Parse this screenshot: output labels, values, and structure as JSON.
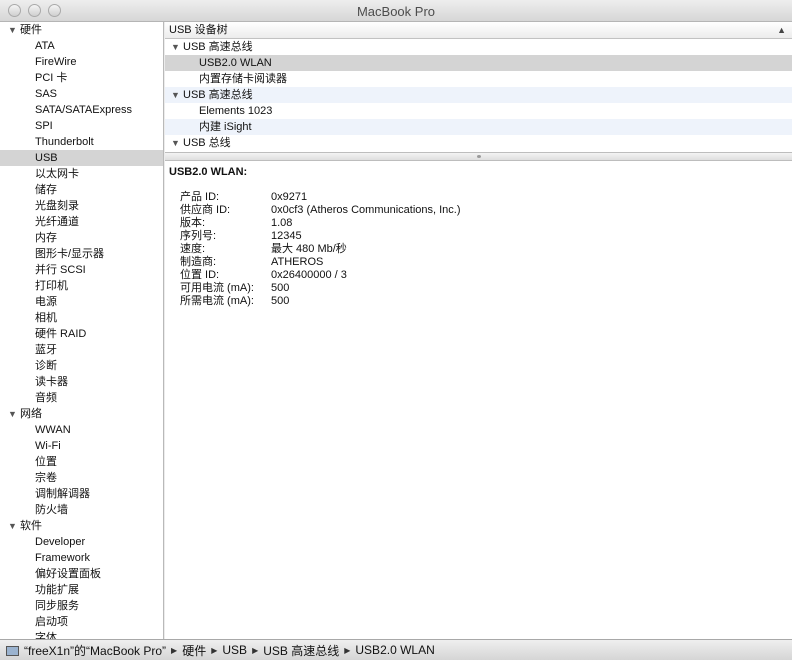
{
  "window": {
    "title": "MacBook Pro"
  },
  "sidebar": {
    "sections": [
      {
        "label": "硬件",
        "items": [
          "ATA",
          "FireWire",
          "PCI 卡",
          "SAS",
          "SATA/SATAExpress",
          "SPI",
          "Thunderbolt",
          "USB",
          "以太网卡",
          "储存",
          "光盘刻录",
          "光纤通道",
          "内存",
          "图形卡/显示器",
          "并行 SCSI",
          "打印机",
          "电源",
          "相机",
          "硬件 RAID",
          "蓝牙",
          "诊断",
          "读卡器",
          "音频"
        ]
      },
      {
        "label": "网络",
        "items": [
          "WWAN",
          "Wi-Fi",
          "位置",
          "宗卷",
          "调制解调器",
          "防火墙"
        ]
      },
      {
        "label": "软件",
        "items": [
          "Developer",
          "Framework",
          "偏好设置面板",
          "功能扩展",
          "同步服务",
          "启动项",
          "字体"
        ]
      }
    ],
    "selected": "USB"
  },
  "tree": {
    "header": "USB 设备树",
    "rows": [
      {
        "label": "USB 高速总线",
        "type": "section"
      },
      {
        "label": "USB2.0 WLAN",
        "type": "child",
        "selected": true
      },
      {
        "label": "内置存储卡阅读器",
        "type": "child"
      },
      {
        "label": "USB 高速总线",
        "type": "section"
      },
      {
        "label": "Elements 1023",
        "type": "child"
      },
      {
        "label": "内建 iSight",
        "type": "child"
      },
      {
        "label": "USB 总线",
        "type": "section"
      }
    ]
  },
  "detail": {
    "title": "USB2.0 WLAN:",
    "properties": [
      {
        "key": "产品 ID:",
        "value": "0x9271"
      },
      {
        "key": "供应商 ID:",
        "value": "0x0cf3  (Atheros Communications, Inc.)"
      },
      {
        "key": "版本:",
        "value": " 1.08"
      },
      {
        "key": "序列号:",
        "value": "12345"
      },
      {
        "key": "速度:",
        "value": "最大 480 Mb/秒"
      },
      {
        "key": "制造商:",
        "value": "ATHEROS"
      },
      {
        "key": "位置 ID:",
        "value": "0x26400000 / 3"
      },
      {
        "key": "可用电流 (mA):",
        "value": "500"
      },
      {
        "key": "所需电流 (mA):",
        "value": "500"
      }
    ]
  },
  "statusbar": {
    "path": [
      "“freeX1n”的“MacBook Pro”",
      "硬件",
      "USB",
      "USB 高速总线",
      "USB2.0 WLAN"
    ]
  }
}
